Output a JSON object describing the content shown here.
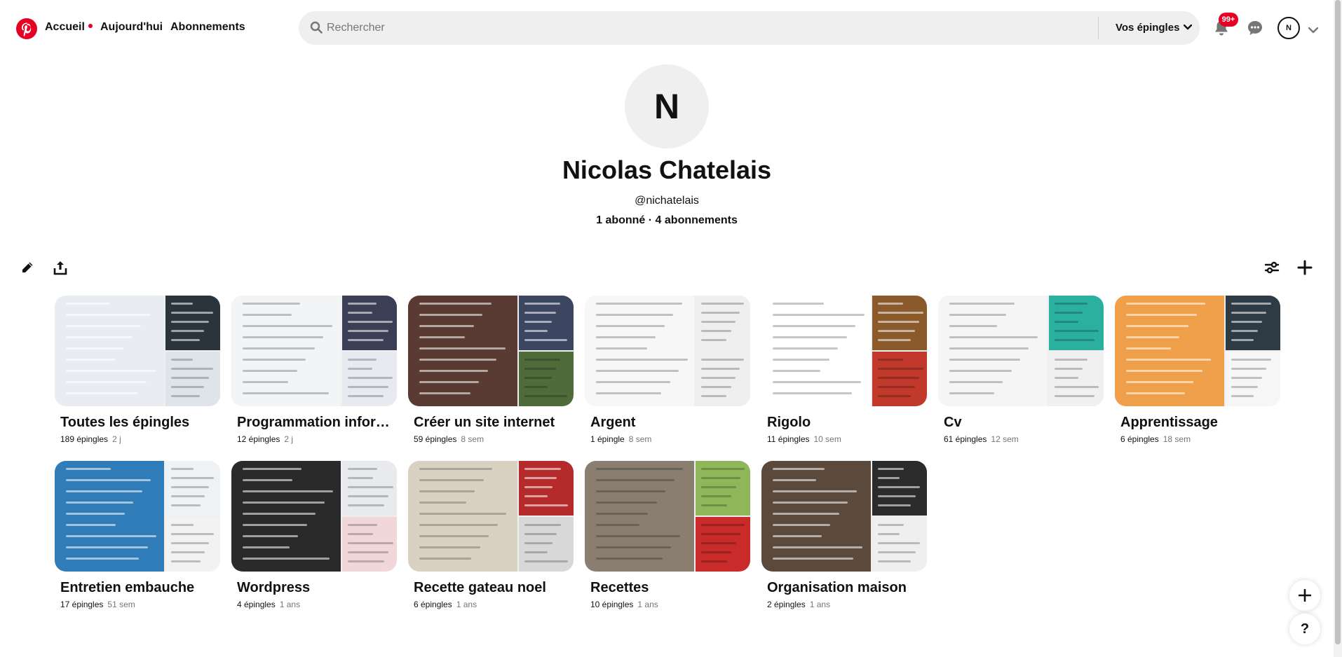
{
  "header": {
    "logo_icon": "pinterest-logo-icon",
    "nav": [
      {
        "label": "Accueil",
        "active_dot": true
      },
      {
        "label": "Aujourd'hui"
      },
      {
        "label": "Abonnements"
      }
    ],
    "search": {
      "placeholder": "Rechercher",
      "scope_label": "Vos épingles"
    },
    "notifications_badge": "99+",
    "avatar_initial": "N",
    "brand_color": "#e60023"
  },
  "profile": {
    "initial": "N",
    "name": "Nicolas Chatelais",
    "handle": "@nichatelais",
    "stats": "1 abonné · 4 abonnements"
  },
  "boards": [
    {
      "title": "Toutes les épingles",
      "count": "189 épingles",
      "age": "2 j"
    },
    {
      "title": "Programmation informatique",
      "count": "12 épingles",
      "age": "2 j"
    },
    {
      "title": "Créer un site internet",
      "count": "59 épingles",
      "age": "8 sem"
    },
    {
      "title": "Argent",
      "count": "1 épingle",
      "age": "8 sem"
    },
    {
      "title": "Rigolo",
      "count": "11 épingles",
      "age": "10 sem"
    },
    {
      "title": "Cv",
      "count": "61 épingles",
      "age": "12 sem"
    },
    {
      "title": "Apprentissage",
      "count": "6 épingles",
      "age": "18 sem"
    },
    {
      "title": "Entretien embauche",
      "count": "17 épingles",
      "age": "51 sem"
    },
    {
      "title": "Wordpress",
      "count": "4 épingles",
      "age": "1 ans"
    },
    {
      "title": "Recette gateau noel",
      "count": "6 épingles",
      "age": "1 ans"
    },
    {
      "title": "Recettes",
      "count": "10 épingles",
      "age": "1 ans"
    },
    {
      "title": "Organisation maison",
      "count": "2 épingles",
      "age": "1 ans"
    }
  ],
  "floating": {
    "help_label": "?"
  }
}
